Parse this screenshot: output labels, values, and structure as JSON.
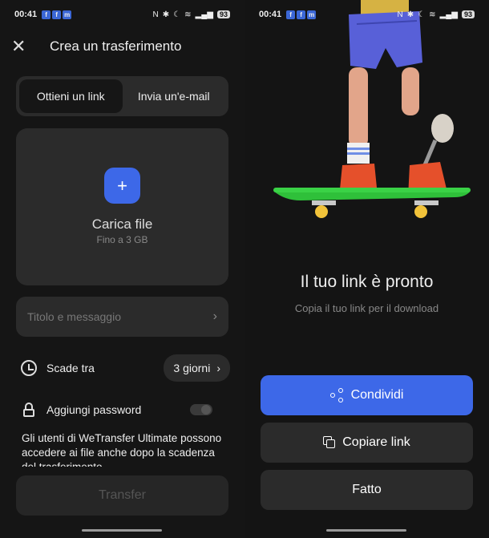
{
  "status": {
    "time": "00:41",
    "battery": "93"
  },
  "left": {
    "header": {
      "title": "Crea un trasferimento"
    },
    "tabs": [
      {
        "label": "Ottieni un link",
        "active": true
      },
      {
        "label": "Invia un'e-mail",
        "active": false
      }
    ],
    "upload": {
      "plus": "+",
      "title": "Carica file",
      "subtitle": "Fino a 3 GB"
    },
    "message": {
      "placeholder": "Titolo e messaggio"
    },
    "expire": {
      "label": "Scade tra",
      "value": "3 giorni"
    },
    "password": {
      "label": "Aggiungi password",
      "enabled": false
    },
    "note": "Gli utenti di WeTransfer Ultimate possono accedere ai file anche dopo la scadenza del trasferimento",
    "transfer_button": "Transfer"
  },
  "right": {
    "ready_title": "Il tuo link è pronto",
    "ready_subtitle": "Copia il tuo link per il download",
    "share_button": "Condividi",
    "copy_button": "Copiare link",
    "done_button": "Fatto"
  },
  "colors": {
    "accent": "#3d68e8",
    "background": "#151515",
    "surface": "#2b2b2b",
    "skateboard": "#2fc03a",
    "shorts": "#5860d8",
    "shoes": "#e5502b"
  }
}
